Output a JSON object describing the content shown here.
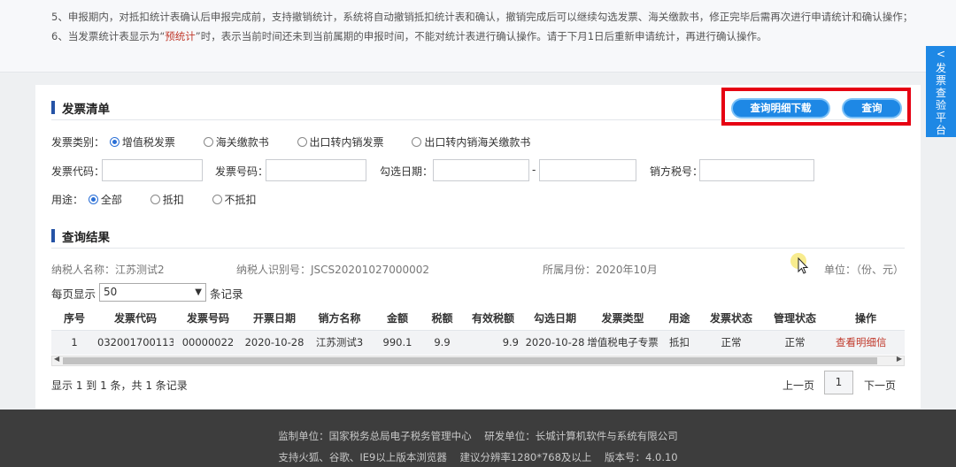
{
  "notice": {
    "line5": "5、申报期内，对抵扣统计表确认后申报完成前，支持撤销统计，系统将自动撤销抵扣统计表和确认，撤销完成后可以继续勾选发票、海关缴款书，修正完毕后需再次进行申请统计和确认操作；",
    "line6_a": "6、当发票统计表显示为“",
    "line6_hl": "预统计",
    "line6_b": "”时，表示当前时间还未到当前属期的申报时间，不能对统计表进行确认操作。请于下月1日后重新申请统计，再进行确认操作。"
  },
  "invoice_list": {
    "title": "发票清单",
    "btn_download": "查询明细下载",
    "btn_query": "查询",
    "type_label": "发票类别：",
    "types": [
      "增值税发票",
      "海关缴款书",
      "出口转内销发票",
      "出口转内销海关缴款书"
    ],
    "selected_type": "增值税发票",
    "code_label": "发票代码：",
    "number_label": "发票号码：",
    "date_label": "勾选日期：",
    "date_sep": "-",
    "seller_tax_label": "销方税号：",
    "code_value": "",
    "number_value": "",
    "date_from": "",
    "date_to": "",
    "seller_tax_value": "",
    "usage_label": "用途：",
    "usages": [
      "全部",
      "抵扣",
      "不抵扣"
    ],
    "selected_usage": "全部"
  },
  "results": {
    "title": "查询结果",
    "taxpayer_name": "纳税人名称：江苏测试2",
    "taxpayer_id": "纳税人识别号：JSCS20201027000002",
    "month": "所属月份：2020年10月",
    "unit": "单位：（份、元）",
    "per_page_label": "每页显示",
    "per_page_value": "50",
    "per_page_suffix": "条记录",
    "columns": [
      "序号",
      "发票代码",
      "发票号码",
      "开票日期",
      "销方名称",
      "金额",
      "税额",
      "有效税额",
      "勾选日期",
      "发票类型",
      "用途",
      "发票状态",
      "管理状态",
      "操作"
    ],
    "rows": [
      [
        "1",
        "032001700113",
        "00000022",
        "2020-10-28",
        "江苏测试3",
        "990.1",
        "9.9",
        "9.9",
        "2020-10-28",
        "增值税电子专票",
        "抵扣",
        "正常",
        "正常",
        "查看明细信"
      ]
    ],
    "summary": "显示 1 到 1 条，共 1 条记录",
    "prev": "上一页",
    "page": "1",
    "next": "下一页"
  },
  "footer": {
    "line1": "监制单位：国家税务总局电子税务管理中心    研发单位：长城计算机软件与系统有限公司",
    "line2": "支持火狐、谷歌、IE9以上版本浏览器    建议分辨率1280*768及以上    版本号：4.0.10"
  },
  "sidetab": {
    "chevron": "<",
    "label": "发票查验平台"
  },
  "colors": {
    "accent": "#1e88e5",
    "highlight_box": "#e60012",
    "link_red": "#c0392b",
    "footer_bg": "#3d3d3d"
  }
}
